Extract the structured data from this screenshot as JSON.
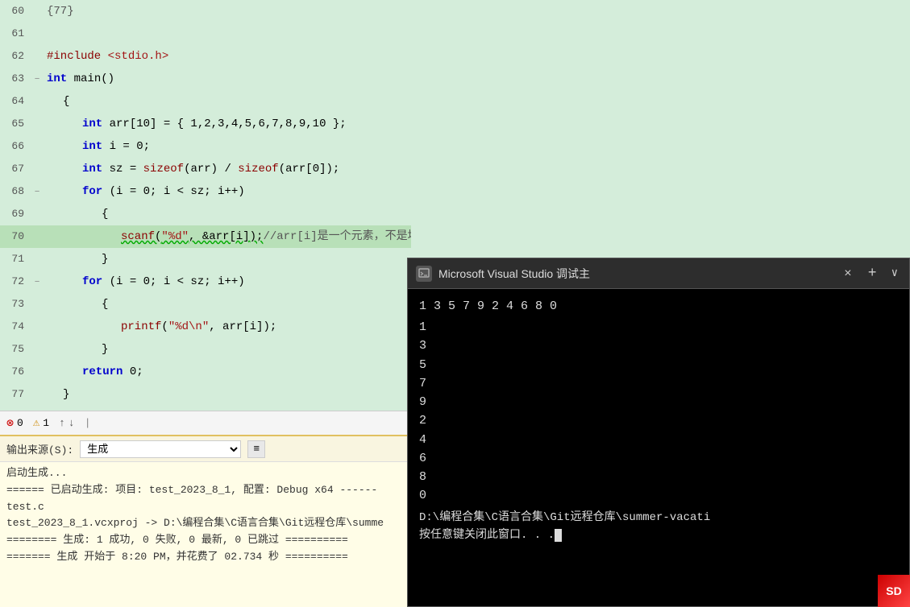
{
  "editor": {
    "background": "#d4edda",
    "lines": [
      {
        "num": 60,
        "indent": 0,
        "content": "{77}"
      },
      {
        "num": 61,
        "indent": 0,
        "content": ""
      },
      {
        "num": 62,
        "indent": 0,
        "content": "#include <stdio.h>",
        "type": "include"
      },
      {
        "num": 63,
        "indent": 0,
        "content": "int main()",
        "type": "func-decl",
        "collapsible": true
      },
      {
        "num": 64,
        "indent": 1,
        "content": "{"
      },
      {
        "num": 65,
        "indent": 2,
        "content": "int arr[10] = { 1,2,3,4,5,6,7,8,9,10 };",
        "type": "var-decl"
      },
      {
        "num": 66,
        "indent": 2,
        "content": "int i = 0;",
        "type": "var-decl"
      },
      {
        "num": 67,
        "indent": 2,
        "content": "int sz = sizeof(arr) / sizeof(arr[0]);",
        "type": "var-decl"
      },
      {
        "num": 68,
        "indent": 2,
        "content": "for (i = 0; i < sz; i++)",
        "type": "for",
        "collapsible": true
      },
      {
        "num": 69,
        "indent": 3,
        "content": "{"
      },
      {
        "num": 70,
        "indent": 4,
        "content": "scanf(\"%d\", &arr[i]);//arr[i]是一个元素，不是地址。地址还要&",
        "type": "scanf",
        "highlight": true
      },
      {
        "num": 71,
        "indent": 3,
        "content": "}"
      },
      {
        "num": 72,
        "indent": 2,
        "content": "for (i = 0; i < sz; i++)",
        "type": "for",
        "collapsible": true
      },
      {
        "num": 73,
        "indent": 3,
        "content": "{"
      },
      {
        "num": 74,
        "indent": 4,
        "content": "printf(\"%d\\n\", arr[i]);",
        "type": "printf"
      },
      {
        "num": 75,
        "indent": 3,
        "content": "}"
      },
      {
        "num": 76,
        "indent": 2,
        "content": "return 0;"
      },
      {
        "num": 77,
        "indent": 1,
        "content": "}"
      }
    ]
  },
  "status_bar": {
    "error_count": "0",
    "warn_count": "1"
  },
  "output_panel": {
    "label": "输出来源(S):",
    "source": "生成",
    "lines": [
      "启动生成...",
      "====== 已启动生成: 项目: test_2023_8_1, 配置: Debug x64 ------",
      "test.c",
      "test_2023_8_1.vcxproj -> D:\\编程合集\\C语言合集\\Git远程仓库\\summe",
      "======== 生成: 1 成功, 0 失败, 0 最新, 0 已跳过 ==========",
      "======= 生成 开始于 8:20 PM，并花费了 02.734 秒 =========="
    ]
  },
  "terminal": {
    "title": "Microsoft Visual Studio 调试主",
    "numbers_row": "1  3  5  7  9  2  4  6  8  0",
    "single_numbers": [
      "1",
      "3",
      "5",
      "7",
      "9",
      "2",
      "4",
      "6",
      "8",
      "0"
    ],
    "path": "D:\\编程合集\\C语言合集\\Git远程仓库\\summer-vacati",
    "prompt": "按任意键关闭此窗口. . .",
    "close_btn": "×",
    "add_tab": "+",
    "dropdown": "∨"
  },
  "watermark": "SD"
}
